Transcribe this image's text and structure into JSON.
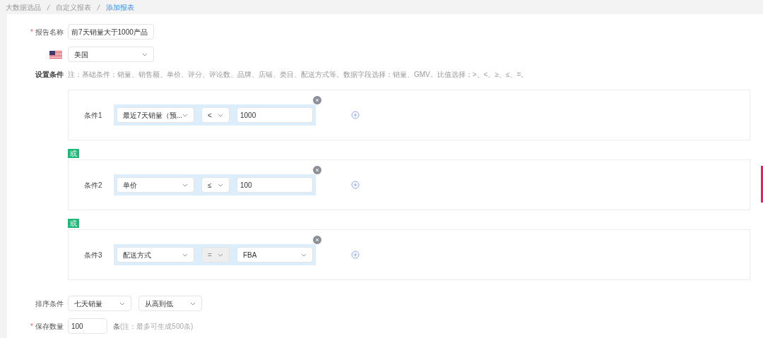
{
  "breadcrumb": [
    {
      "label": "大数据选品",
      "selected": false
    },
    {
      "label": "自定义报表",
      "selected": false
    },
    {
      "label": "添加报表",
      "selected": true
    }
  ],
  "report_name": {
    "label": "报告名称",
    "required": "*",
    "value": "前7天销量大于1000产品"
  },
  "country": {
    "value": "美国"
  },
  "conditions_label": "设置条件",
  "conditions_note": "注：基础条件：销量、销售额、单价、评分、评论数、品牌、店铺、类目、配送方式等。数据字段选择：销量、GMV。比值选择：>、<、≥、≤、=。",
  "conditions": [
    {
      "label": "条件1",
      "field": "最近7天销量（预...",
      "operator": {
        "value": "<",
        "disabled": false
      },
      "value": {
        "kind": "input",
        "text": "1000"
      }
    },
    {
      "connector": "或",
      "label": "条件2",
      "field": "单价",
      "operator": {
        "value": "≤",
        "disabled": false
      },
      "value": {
        "kind": "input",
        "text": "100"
      }
    },
    {
      "connector": "或",
      "label": "条件3",
      "field": "配送方式",
      "operator": {
        "value": "=",
        "disabled": true
      },
      "value": {
        "kind": "select",
        "text": "FBA"
      }
    }
  ],
  "sort": {
    "label": "排序条件",
    "field": "七天销量",
    "order": "从高到低"
  },
  "save_count": {
    "label": "保存数量",
    "required": "*",
    "value": "100",
    "unit": "条",
    "note": "(注：最多可生成500条)"
  }
}
